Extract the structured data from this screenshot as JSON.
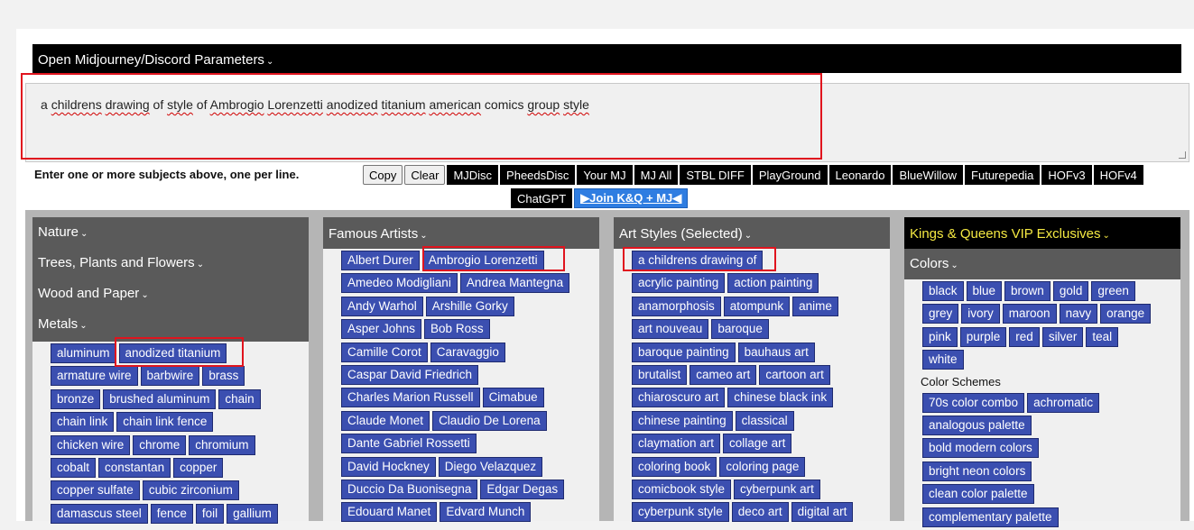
{
  "params_bar": {
    "label": "Open Midjourney/Discord Parameters"
  },
  "prompt": {
    "words": [
      "a",
      "childrens",
      "drawing",
      "of",
      "style",
      "of",
      "Ambrogio",
      "Lorenzetti",
      "anodized",
      "titanium",
      "american",
      "comics",
      "group",
      "style"
    ],
    "misspelled": [
      1,
      2,
      4,
      6,
      7,
      8,
      9,
      10,
      12,
      13
    ]
  },
  "instruction": "Enter one or more subjects above, one per line.",
  "buttons": {
    "copy": "Copy",
    "clear": "Clear",
    "links_row1": [
      "MJDisc",
      "PheedsDisc",
      "Your MJ",
      "MJ All",
      "STBL DIFF",
      "PlayGround",
      "Leonardo",
      "BlueWillow",
      "Futurepedia",
      "HOFv3",
      "HOFv4"
    ],
    "links_row2": [
      "ChatGPT"
    ],
    "join": "▶Join K&Q + MJ◀"
  },
  "col1": {
    "menu": [
      "Nature",
      "Trees, Plants and Flowers",
      "Wood and Paper"
    ],
    "section": "Metals",
    "rows": [
      [
        "aluminum",
        "anodized titanium"
      ],
      [
        "armature wire",
        "barbwire",
        "brass"
      ],
      [
        "bronze",
        "brushed aluminum",
        "chain"
      ],
      [
        "chain link",
        "chain link fence"
      ],
      [
        "chicken wire",
        "chrome",
        "chromium"
      ],
      [
        "cobalt",
        "constantan",
        "copper"
      ],
      [
        "copper sulfate",
        "cubic zirconium"
      ],
      [
        "damascus steel",
        "fence",
        "foil",
        "gallium"
      ]
    ]
  },
  "col2": {
    "section": "Famous Artists",
    "rows": [
      [
        "Albert Durer",
        "Ambrogio Lorenzetti"
      ],
      [
        "Amedeo Modigliani",
        "Andrea Mantegna"
      ],
      [
        "Andy Warhol",
        "Arshille Gorky"
      ],
      [
        "Asper Johns",
        "Bob Ross"
      ],
      [
        "Camille Corot",
        "Caravaggio"
      ],
      [
        "Caspar David Friedrich"
      ],
      [
        "Charles Marion Russell",
        "Cimabue"
      ],
      [
        "Claude Monet",
        "Claudio De Lorena"
      ],
      [
        "Dante Gabriel Rossetti"
      ],
      [
        "David Hockney",
        "Diego Velazquez"
      ],
      [
        "Duccio Da Buonisegna",
        "Edgar Degas"
      ],
      [
        "Edouard Manet",
        "Edvard Munch"
      ]
    ]
  },
  "col3": {
    "section": "Art Styles (Selected)",
    "rows": [
      [
        "a childrens drawing of"
      ],
      [
        "acrylic painting",
        "action painting"
      ],
      [
        "anamorphosis",
        "atompunk",
        "anime"
      ],
      [
        "art nouveau",
        "baroque"
      ],
      [
        "baroque painting",
        "bauhaus art"
      ],
      [
        "brutalist",
        "cameo art",
        "cartoon art"
      ],
      [
        "chiaroscuro art",
        "chinese black ink"
      ],
      [
        "chinese painting",
        "classical"
      ],
      [
        "claymation art",
        "collage art"
      ],
      [
        "coloring book",
        "coloring page"
      ],
      [
        "comicbook style",
        "cyberpunk art"
      ],
      [
        "cyberpunk style",
        "deco art",
        "digital art"
      ]
    ]
  },
  "col4": {
    "title": "Kings & Queens VIP Exclusives",
    "section": "Colors",
    "rows": [
      [
        "black",
        "blue",
        "brown",
        "gold",
        "green"
      ],
      [
        "grey",
        "ivory",
        "maroon",
        "navy",
        "orange"
      ],
      [
        "pink",
        "purple",
        "red",
        "silver",
        "teal"
      ],
      [
        "white"
      ]
    ],
    "schemes_label": "Color Schemes",
    "scheme_rows": [
      [
        "70s color combo",
        "achromatic"
      ],
      [
        "analogous palette"
      ],
      [
        "bold modern colors"
      ],
      [
        "bright neon colors"
      ],
      [
        "clean color palette"
      ],
      [
        "complementary palette"
      ]
    ]
  },
  "colors": {
    "tag_bg": "#3b4fb0",
    "highlight": "#e0141e",
    "vip_text": "#f5e942",
    "join_bg": "#2f7de1"
  }
}
